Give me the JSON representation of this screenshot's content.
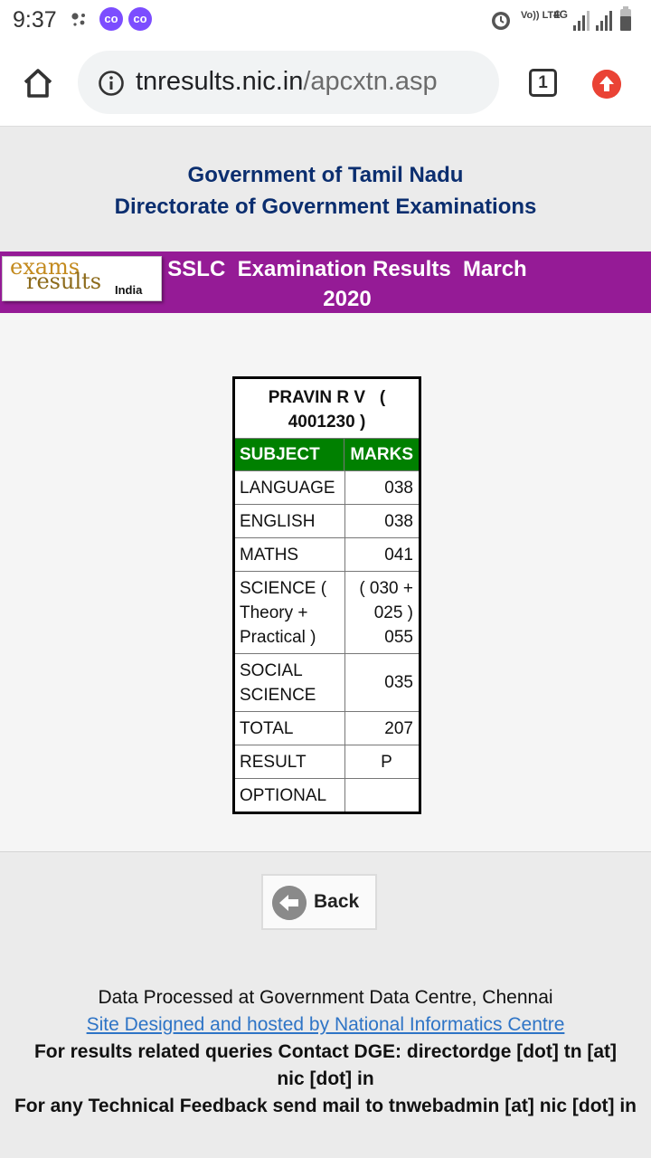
{
  "status_bar": {
    "time": "9:37",
    "carrier_badges": [
      "co",
      "co"
    ],
    "network_label_1": "Vo)) LTE",
    "network_label_2": "4G"
  },
  "browser": {
    "url_host": "tnresults.nic.in",
    "url_path": "/apcxtn.asp",
    "tab_count": "1"
  },
  "header": {
    "line1": "Government of Tamil Nadu",
    "line2": "Directorate of Government Examinations"
  },
  "banner": {
    "logo": {
      "line1": "exams",
      "line2": "results",
      "line3": "India"
    },
    "title_line1": "SSLC  Examination Results  March",
    "title_line2": "2020"
  },
  "results": {
    "student_line1": "PRAVIN R V   (",
    "student_line2": "4001230 )",
    "col_subject": "SUBJECT",
    "col_marks": "MARKS",
    "rows": [
      {
        "subject": "LANGUAGE",
        "marks": "038"
      },
      {
        "subject": "ENGLISH",
        "marks": "038"
      },
      {
        "subject": "MATHS",
        "marks": "041"
      },
      {
        "subject": "SCIENCE ( Theory + Practical )",
        "marks": "( 030 + 025 ) 055"
      },
      {
        "subject": "SOCIAL SCIENCE",
        "marks": "035"
      },
      {
        "subject": "TOTAL",
        "marks": "207"
      },
      {
        "subject": "RESULT",
        "marks": "P"
      },
      {
        "subject": "OPTIONAL",
        "marks": ""
      }
    ]
  },
  "back_button": {
    "label": "Back"
  },
  "footer": {
    "line1": "Data Processed at Government Data Centre, Chennai",
    "link_text": "Site Designed and hosted by National Informatics Centre",
    "line3": "For results related queries Contact DGE:  directordge [dot] tn [at] nic [dot] in",
    "line4": "For any Technical Feedback send mail to tnwebadmin [at] nic [dot] in"
  },
  "colors": {
    "purple_banner": "#951b96",
    "header_green": "#008000",
    "heading_blue": "#0b2e6f",
    "link_blue": "#2e74c6"
  }
}
